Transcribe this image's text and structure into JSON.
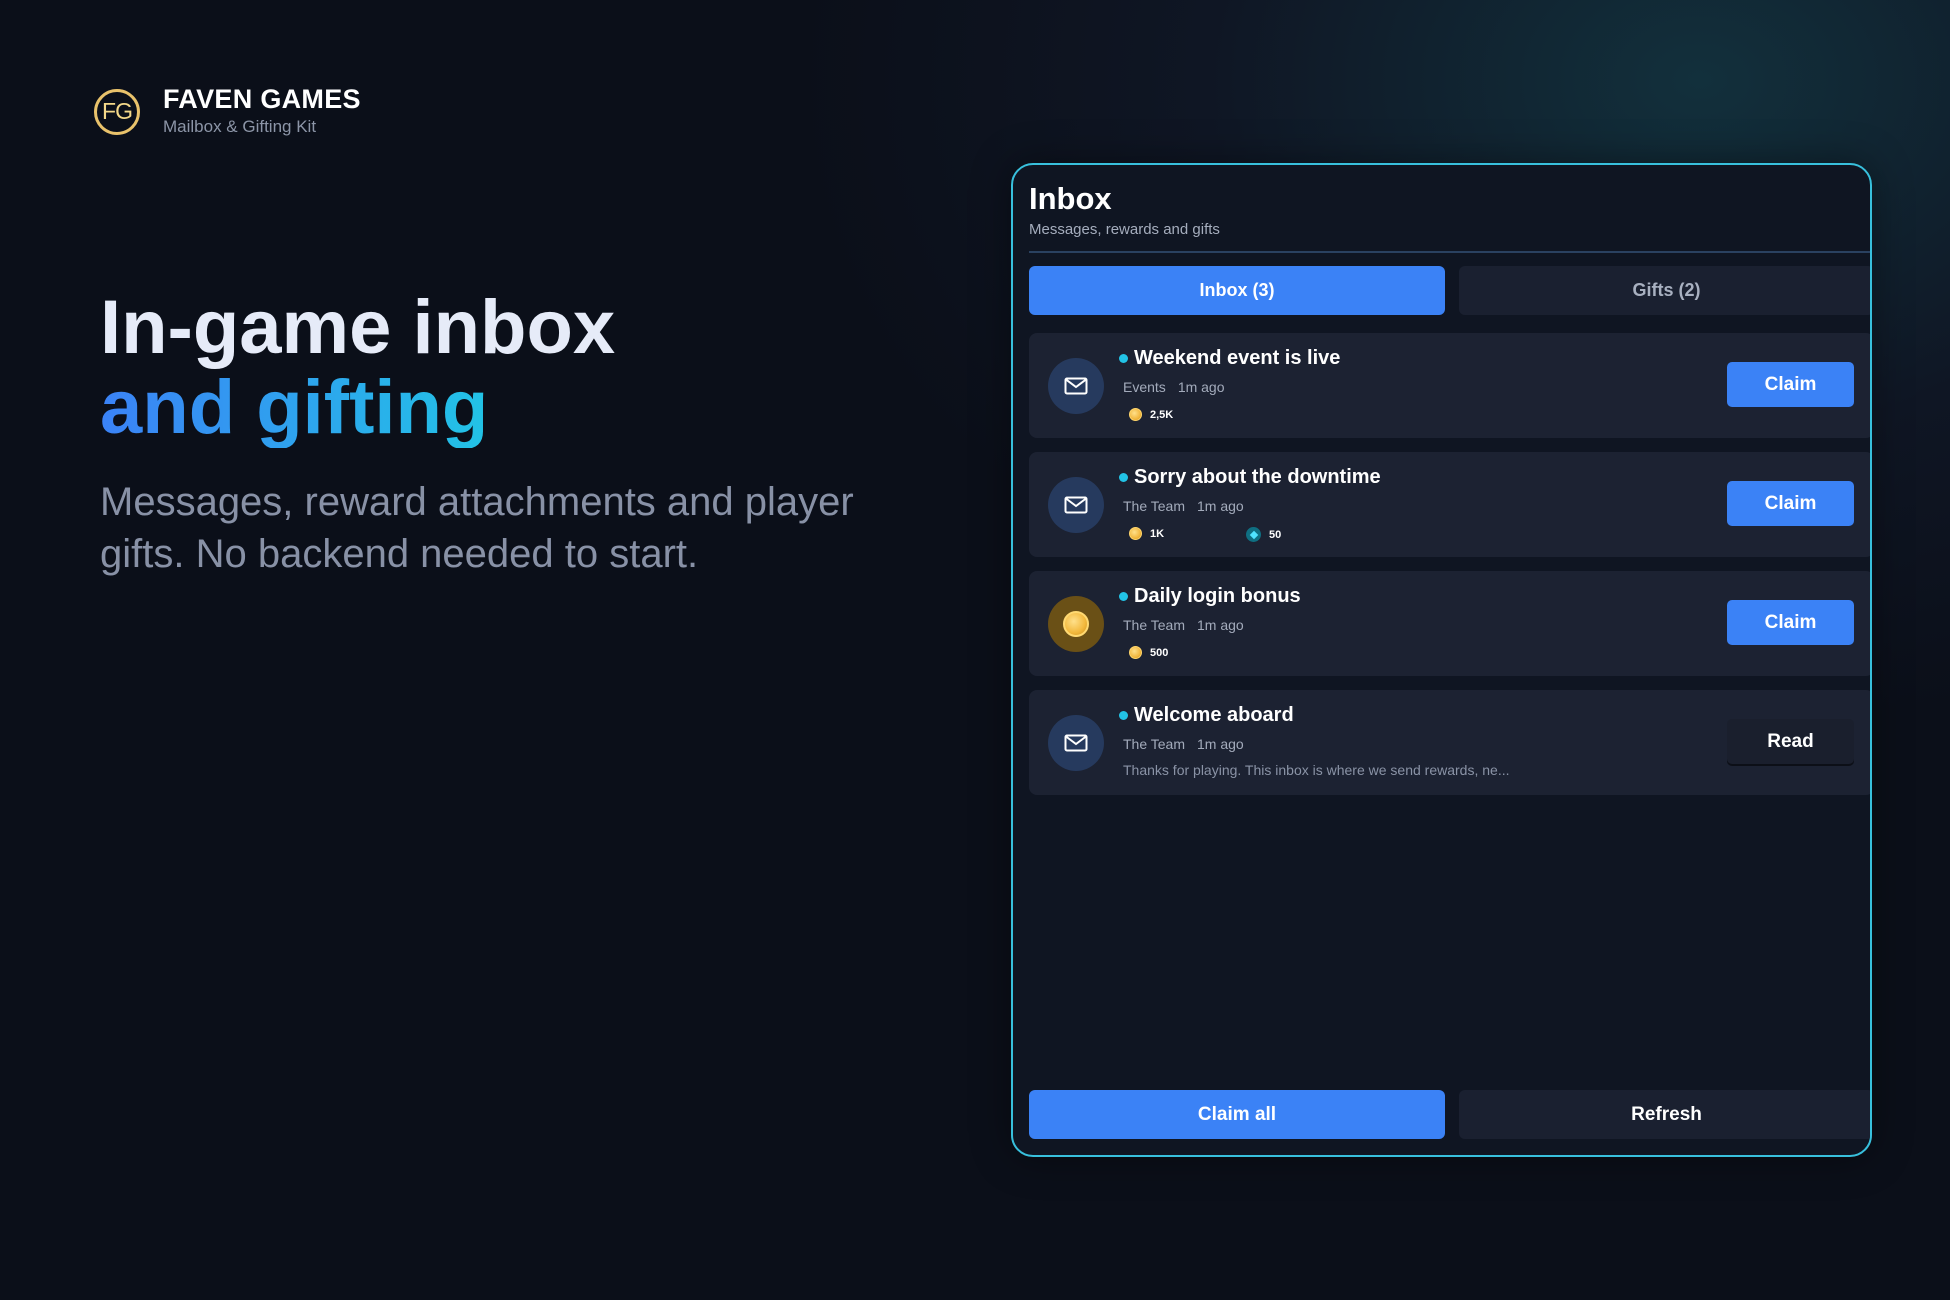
{
  "brand": {
    "logo_text": "FG",
    "name": "FAVEN GAMES",
    "subtitle": "Mailbox & Gifting Kit"
  },
  "hero": {
    "title_line1": "In-game inbox",
    "title_line2": "and gifting",
    "subtitle": "Messages, reward attachments and player gifts. No backend needed to start."
  },
  "panel": {
    "title": "Inbox",
    "subtitle": "Messages, rewards and gifts",
    "tabs": [
      {
        "label": "Inbox  (3)",
        "active": true
      },
      {
        "label": "Gifts  (2)",
        "active": false
      }
    ],
    "messages": [
      {
        "title": "Weekend event is live",
        "sender": "Events",
        "time": "1m ago",
        "icon": "envelope-icon",
        "rewards": [
          {
            "icon": "coin-icon",
            "value": "2,5K"
          }
        ],
        "action": "Claim"
      },
      {
        "title": "Sorry about the downtime",
        "sender": "The Team",
        "time": "1m ago",
        "icon": "envelope-icon",
        "rewards": [
          {
            "icon": "coin-icon",
            "value": "1K"
          },
          {
            "icon": "gem-icon",
            "value": "50"
          }
        ],
        "action": "Claim"
      },
      {
        "title": "Daily login bonus",
        "sender": "The Team",
        "time": "1m ago",
        "icon": "coin-icon",
        "rewards": [
          {
            "icon": "coin-icon",
            "value": "500"
          }
        ],
        "action": "Claim"
      },
      {
        "title": "Welcome aboard",
        "sender": "The Team",
        "time": "1m ago",
        "icon": "envelope-icon",
        "preview": "Thanks for playing. This inbox is where we send rewards, ne...",
        "action": "Read"
      }
    ],
    "footer": {
      "claim_all": "Claim all",
      "refresh": "Refresh"
    }
  },
  "colors": {
    "accent": "#3b82f6",
    "cyan": "#22c3e6",
    "gold": "#e9c26b",
    "background": "#0b0f19"
  }
}
